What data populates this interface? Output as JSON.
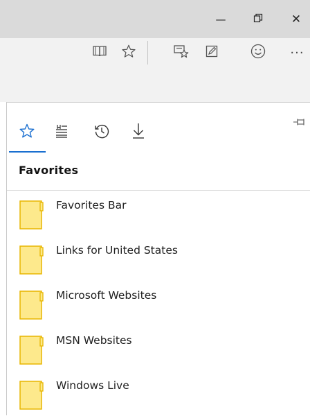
{
  "window_controls": {
    "minimize_glyph": "—",
    "restore_glyph": "❐",
    "close_glyph": "✕"
  },
  "toolbar": {
    "icons": [
      "reading-view-icon",
      "add-favorite-icon",
      "hub-icon",
      "web-note-icon",
      "feedback-icon",
      "more-icon"
    ],
    "more_glyph": "···"
  },
  "hub": {
    "tabs": [
      {
        "name": "favorites",
        "icon": "star-icon",
        "active": true
      },
      {
        "name": "reading-list",
        "icon": "reading-list-icon",
        "active": false
      },
      {
        "name": "history",
        "icon": "history-icon",
        "active": false
      },
      {
        "name": "downloads",
        "icon": "download-icon",
        "active": false
      }
    ],
    "section_title": "Favorites",
    "items": [
      {
        "label": "Favorites Bar"
      },
      {
        "label": "Links for United States"
      },
      {
        "label": "Microsoft Websites"
      },
      {
        "label": "MSN Websites"
      },
      {
        "label": "Windows Live"
      }
    ]
  },
  "colors": {
    "accent": "#1a6fd0",
    "folder_fill": "#fde98c",
    "folder_edge": "#e8b600",
    "titlebar": "#dadada",
    "toolbar": "#f2f2f2"
  }
}
